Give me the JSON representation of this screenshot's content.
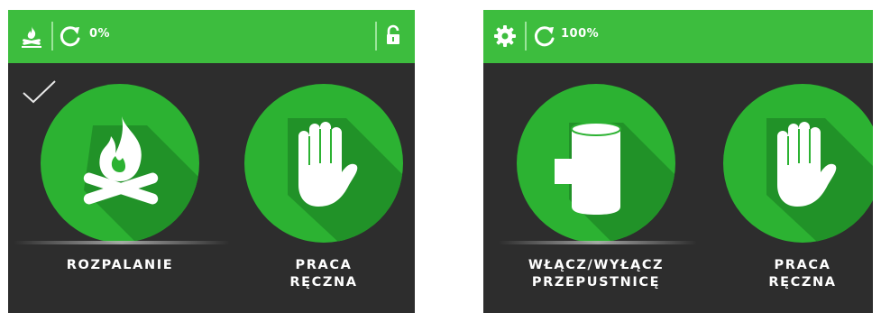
{
  "colors": {
    "accent_green": "#3dbd3e",
    "circle_green": "#2cb232",
    "background": "#2d2d2d",
    "icon_fill": "#ffffff"
  },
  "left_screen": {
    "topbar": {
      "icons": [
        "campfire-icon",
        "refresh-icon",
        "unlock-icon"
      ],
      "percent": "0%"
    },
    "tiles": [
      {
        "label_lines": [
          "ROZPALANIE"
        ],
        "icon": "campfire-icon",
        "selected": true
      },
      {
        "label_lines": [
          "PRACA",
          "RĘCZNA"
        ],
        "icon": "hand-icon",
        "selected": false
      }
    ]
  },
  "right_screen": {
    "topbar": {
      "icons": [
        "gear-icon",
        "refresh-icon"
      ],
      "percent": "100%"
    },
    "tiles": [
      {
        "label_lines": [
          "WŁĄCZ/WYŁĄCZ",
          "PRZEPUSTNICĘ"
        ],
        "icon": "damper-icon",
        "selected": true
      },
      {
        "label_lines": [
          "PRACA",
          "RĘCZNA"
        ],
        "icon": "hand-icon",
        "selected": false
      }
    ]
  }
}
